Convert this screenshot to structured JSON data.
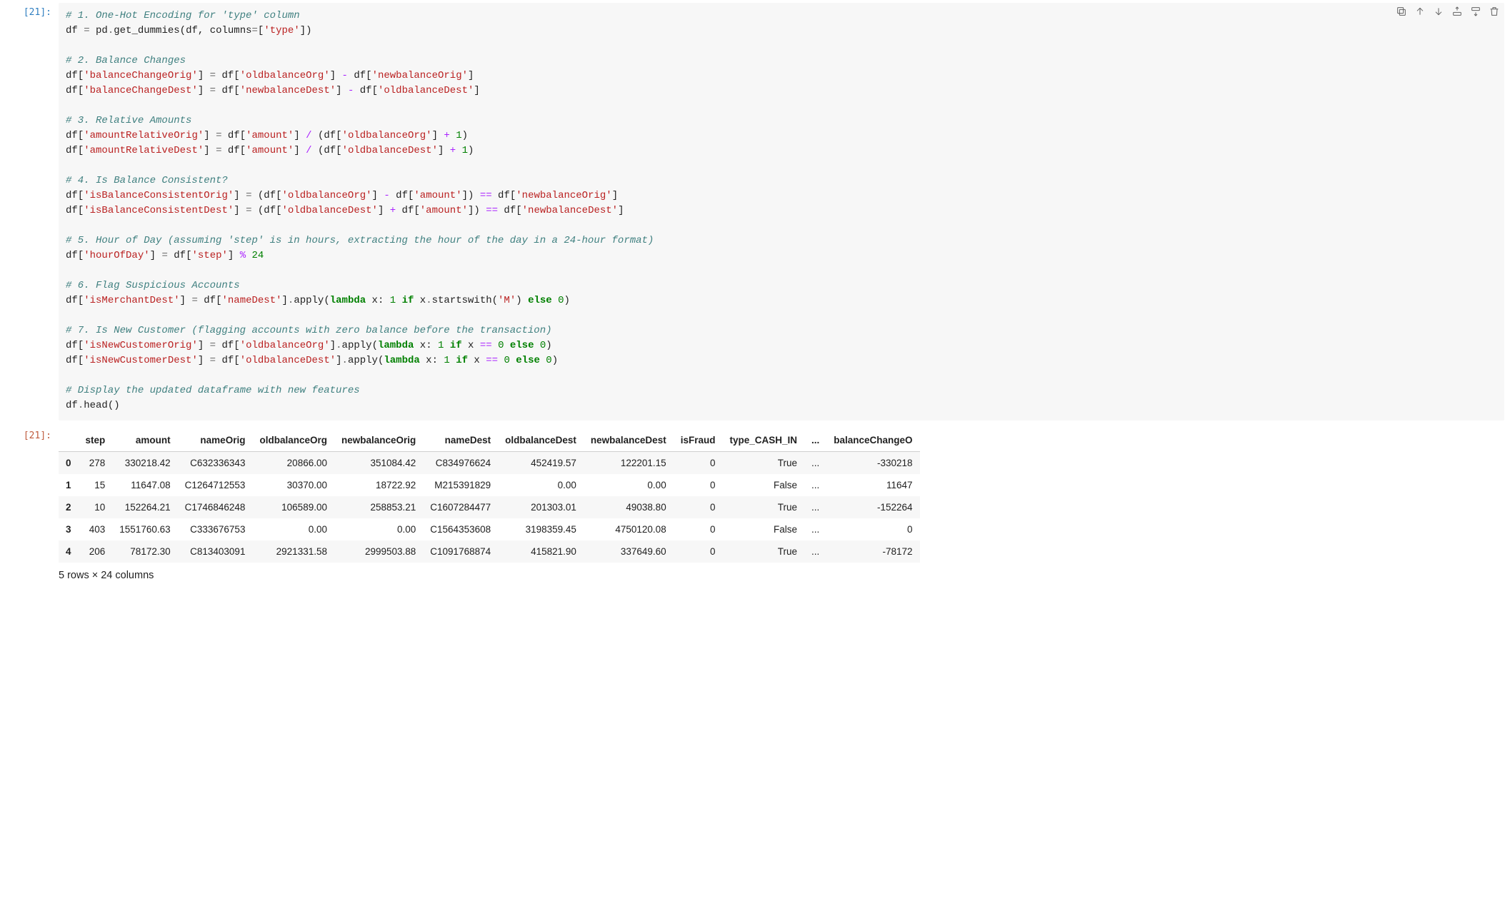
{
  "cell": {
    "in_prompt": "[21]:",
    "out_prompt": "[21]:",
    "code_lines": [
      [
        [
          "cm",
          "# 1. One-Hot Encoding for 'type' column"
        ]
      ],
      [
        [
          "nm",
          "df "
        ],
        [
          "eq",
          "="
        ],
        [
          "nm",
          " pd"
        ],
        [
          "dot",
          "."
        ],
        [
          "nm",
          "get_dummies"
        ],
        [
          "pn",
          "("
        ],
        [
          "nm",
          "df"
        ],
        [
          "pn",
          ", "
        ],
        [
          "nm",
          "columns"
        ],
        [
          "eq",
          "="
        ],
        [
          "pn",
          "["
        ],
        [
          "s",
          "'type'"
        ],
        [
          "pn",
          "])"
        ]
      ],
      [],
      [
        [
          "cm",
          "# 2. Balance Changes"
        ]
      ],
      [
        [
          "nm",
          "df"
        ],
        [
          "pn",
          "["
        ],
        [
          "s",
          "'balanceChangeOrig'"
        ],
        [
          "pn",
          "] "
        ],
        [
          "eq",
          "="
        ],
        [
          "nm",
          " df"
        ],
        [
          "pn",
          "["
        ],
        [
          "s",
          "'oldbalanceOrg'"
        ],
        [
          "pn",
          "] "
        ],
        [
          "op",
          "-"
        ],
        [
          "nm",
          " df"
        ],
        [
          "pn",
          "["
        ],
        [
          "s",
          "'newbalanceOrig'"
        ],
        [
          "pn",
          "]"
        ]
      ],
      [
        [
          "nm",
          "df"
        ],
        [
          "pn",
          "["
        ],
        [
          "s",
          "'balanceChangeDest'"
        ],
        [
          "pn",
          "] "
        ],
        [
          "eq",
          "="
        ],
        [
          "nm",
          " df"
        ],
        [
          "pn",
          "["
        ],
        [
          "s",
          "'newbalanceDest'"
        ],
        [
          "pn",
          "] "
        ],
        [
          "op",
          "-"
        ],
        [
          "nm",
          " df"
        ],
        [
          "pn",
          "["
        ],
        [
          "s",
          "'oldbalanceDest'"
        ],
        [
          "pn",
          "]"
        ]
      ],
      [],
      [
        [
          "cm",
          "# 3. Relative Amounts"
        ]
      ],
      [
        [
          "nm",
          "df"
        ],
        [
          "pn",
          "["
        ],
        [
          "s",
          "'amountRelativeOrig'"
        ],
        [
          "pn",
          "] "
        ],
        [
          "eq",
          "="
        ],
        [
          "nm",
          " df"
        ],
        [
          "pn",
          "["
        ],
        [
          "s",
          "'amount'"
        ],
        [
          "pn",
          "] "
        ],
        [
          "op",
          "/"
        ],
        [
          "nm",
          " "
        ],
        [
          "pn",
          "("
        ],
        [
          "nm",
          "df"
        ],
        [
          "pn",
          "["
        ],
        [
          "s",
          "'oldbalanceOrg'"
        ],
        [
          "pn",
          "] "
        ],
        [
          "op",
          "+"
        ],
        [
          "nm",
          " "
        ],
        [
          "n",
          "1"
        ],
        [
          "pn",
          ")"
        ]
      ],
      [
        [
          "nm",
          "df"
        ],
        [
          "pn",
          "["
        ],
        [
          "s",
          "'amountRelativeDest'"
        ],
        [
          "pn",
          "] "
        ],
        [
          "eq",
          "="
        ],
        [
          "nm",
          " df"
        ],
        [
          "pn",
          "["
        ],
        [
          "s",
          "'amount'"
        ],
        [
          "pn",
          "] "
        ],
        [
          "op",
          "/"
        ],
        [
          "nm",
          " "
        ],
        [
          "pn",
          "("
        ],
        [
          "nm",
          "df"
        ],
        [
          "pn",
          "["
        ],
        [
          "s",
          "'oldbalanceDest'"
        ],
        [
          "pn",
          "] "
        ],
        [
          "op",
          "+"
        ],
        [
          "nm",
          " "
        ],
        [
          "n",
          "1"
        ],
        [
          "pn",
          ")"
        ]
      ],
      [],
      [
        [
          "cm",
          "# 4. Is Balance Consistent?"
        ]
      ],
      [
        [
          "nm",
          "df"
        ],
        [
          "pn",
          "["
        ],
        [
          "s",
          "'isBalanceConsistentOrig'"
        ],
        [
          "pn",
          "] "
        ],
        [
          "eq",
          "="
        ],
        [
          "nm",
          " "
        ],
        [
          "pn",
          "("
        ],
        [
          "nm",
          "df"
        ],
        [
          "pn",
          "["
        ],
        [
          "s",
          "'oldbalanceOrg'"
        ],
        [
          "pn",
          "] "
        ],
        [
          "op",
          "-"
        ],
        [
          "nm",
          " df"
        ],
        [
          "pn",
          "["
        ],
        [
          "s",
          "'amount'"
        ],
        [
          "pn",
          "]) "
        ],
        [
          "op",
          "=="
        ],
        [
          "nm",
          " df"
        ],
        [
          "pn",
          "["
        ],
        [
          "s",
          "'newbalanceOrig'"
        ],
        [
          "pn",
          "]"
        ]
      ],
      [
        [
          "nm",
          "df"
        ],
        [
          "pn",
          "["
        ],
        [
          "s",
          "'isBalanceConsistentDest'"
        ],
        [
          "pn",
          "] "
        ],
        [
          "eq",
          "="
        ],
        [
          "nm",
          " "
        ],
        [
          "pn",
          "("
        ],
        [
          "nm",
          "df"
        ],
        [
          "pn",
          "["
        ],
        [
          "s",
          "'oldbalanceDest'"
        ],
        [
          "pn",
          "] "
        ],
        [
          "op",
          "+"
        ],
        [
          "nm",
          " df"
        ],
        [
          "pn",
          "["
        ],
        [
          "s",
          "'amount'"
        ],
        [
          "pn",
          "]) "
        ],
        [
          "op",
          "=="
        ],
        [
          "nm",
          " df"
        ],
        [
          "pn",
          "["
        ],
        [
          "s",
          "'newbalanceDest'"
        ],
        [
          "pn",
          "]"
        ]
      ],
      [],
      [
        [
          "cm",
          "# 5. Hour of Day (assuming 'step' is in hours, extracting the hour of the day in a 24-hour format)"
        ]
      ],
      [
        [
          "nm",
          "df"
        ],
        [
          "pn",
          "["
        ],
        [
          "s",
          "'hourOfDay'"
        ],
        [
          "pn",
          "] "
        ],
        [
          "eq",
          "="
        ],
        [
          "nm",
          " df"
        ],
        [
          "pn",
          "["
        ],
        [
          "s",
          "'step'"
        ],
        [
          "pn",
          "] "
        ],
        [
          "op",
          "%"
        ],
        [
          "nm",
          " "
        ],
        [
          "n",
          "24"
        ]
      ],
      [],
      [
        [
          "cm",
          "# 6. Flag Suspicious Accounts"
        ]
      ],
      [
        [
          "nm",
          "df"
        ],
        [
          "pn",
          "["
        ],
        [
          "s",
          "'isMerchantDest'"
        ],
        [
          "pn",
          "] "
        ],
        [
          "eq",
          "="
        ],
        [
          "nm",
          " df"
        ],
        [
          "pn",
          "["
        ],
        [
          "s",
          "'nameDest'"
        ],
        [
          "pn",
          "]"
        ],
        [
          "dot",
          "."
        ],
        [
          "nm",
          "apply"
        ],
        [
          "pn",
          "("
        ],
        [
          "kw",
          "lambda"
        ],
        [
          "nm",
          " x: "
        ],
        [
          "n",
          "1"
        ],
        [
          "nm",
          " "
        ],
        [
          "kw",
          "if"
        ],
        [
          "nm",
          " x"
        ],
        [
          "dot",
          "."
        ],
        [
          "nm",
          "startswith"
        ],
        [
          "pn",
          "("
        ],
        [
          "s",
          "'M'"
        ],
        [
          "pn",
          ") "
        ],
        [
          "kw",
          "else"
        ],
        [
          "nm",
          " "
        ],
        [
          "n",
          "0"
        ],
        [
          "pn",
          ")"
        ]
      ],
      [],
      [
        [
          "cm",
          "# 7. Is New Customer (flagging accounts with zero balance before the transaction)"
        ]
      ],
      [
        [
          "nm",
          "df"
        ],
        [
          "pn",
          "["
        ],
        [
          "s",
          "'isNewCustomerOrig'"
        ],
        [
          "pn",
          "] "
        ],
        [
          "eq",
          "="
        ],
        [
          "nm",
          " df"
        ],
        [
          "pn",
          "["
        ],
        [
          "s",
          "'oldbalanceOrg'"
        ],
        [
          "pn",
          "]"
        ],
        [
          "dot",
          "."
        ],
        [
          "nm",
          "apply"
        ],
        [
          "pn",
          "("
        ],
        [
          "kw",
          "lambda"
        ],
        [
          "nm",
          " x: "
        ],
        [
          "n",
          "1"
        ],
        [
          "nm",
          " "
        ],
        [
          "kw",
          "if"
        ],
        [
          "nm",
          " x "
        ],
        [
          "op",
          "=="
        ],
        [
          "nm",
          " "
        ],
        [
          "n",
          "0"
        ],
        [
          "nm",
          " "
        ],
        [
          "kw",
          "else"
        ],
        [
          "nm",
          " "
        ],
        [
          "n",
          "0"
        ],
        [
          "pn",
          ")"
        ]
      ],
      [
        [
          "nm",
          "df"
        ],
        [
          "pn",
          "["
        ],
        [
          "s",
          "'isNewCustomerDest'"
        ],
        [
          "pn",
          "] "
        ],
        [
          "eq",
          "="
        ],
        [
          "nm",
          " df"
        ],
        [
          "pn",
          "["
        ],
        [
          "s",
          "'oldbalanceDest'"
        ],
        [
          "pn",
          "]"
        ],
        [
          "dot",
          "."
        ],
        [
          "nm",
          "apply"
        ],
        [
          "pn",
          "("
        ],
        [
          "kw",
          "lambda"
        ],
        [
          "nm",
          " x: "
        ],
        [
          "n",
          "1"
        ],
        [
          "nm",
          " "
        ],
        [
          "kw",
          "if"
        ],
        [
          "nm",
          " x "
        ],
        [
          "op",
          "=="
        ],
        [
          "nm",
          " "
        ],
        [
          "n",
          "0"
        ],
        [
          "nm",
          " "
        ],
        [
          "kw",
          "else"
        ],
        [
          "nm",
          " "
        ],
        [
          "n",
          "0"
        ],
        [
          "pn",
          ")"
        ]
      ],
      [],
      [
        [
          "cm",
          "# Display the updated dataframe with new features"
        ]
      ],
      [
        [
          "nm",
          "df"
        ],
        [
          "dot",
          "."
        ],
        [
          "nm",
          "head"
        ],
        [
          "pn",
          "()"
        ]
      ]
    ]
  },
  "toolbar": {
    "buttons": [
      "duplicate",
      "move-up",
      "move-down",
      "insert-above",
      "insert-below",
      "delete"
    ]
  },
  "dataframe": {
    "columns": [
      "step",
      "amount",
      "nameOrig",
      "oldbalanceOrg",
      "newbalanceOrig",
      "nameDest",
      "oldbalanceDest",
      "newbalanceDest",
      "isFraud",
      "type_CASH_IN",
      "...",
      "balanceChangeO"
    ],
    "index": [
      "0",
      "1",
      "2",
      "3",
      "4"
    ],
    "rows": [
      [
        "278",
        "330218.42",
        "C632336343",
        "20866.00",
        "351084.42",
        "C834976624",
        "452419.57",
        "122201.15",
        "0",
        "True",
        "...",
        "-330218"
      ],
      [
        "15",
        "11647.08",
        "C1264712553",
        "30370.00",
        "18722.92",
        "M215391829",
        "0.00",
        "0.00",
        "0",
        "False",
        "...",
        "11647"
      ],
      [
        "10",
        "152264.21",
        "C1746846248",
        "106589.00",
        "258853.21",
        "C1607284477",
        "201303.01",
        "49038.80",
        "0",
        "True",
        "...",
        "-152264"
      ],
      [
        "403",
        "1551760.63",
        "C333676753",
        "0.00",
        "0.00",
        "C1564353608",
        "3198359.45",
        "4750120.08",
        "0",
        "False",
        "...",
        "0"
      ],
      [
        "206",
        "78172.30",
        "C813403091",
        "2921331.58",
        "2999503.88",
        "C1091768874",
        "415821.90",
        "337649.60",
        "0",
        "True",
        "...",
        "-78172"
      ]
    ],
    "summary": "5 rows × 24 columns"
  }
}
